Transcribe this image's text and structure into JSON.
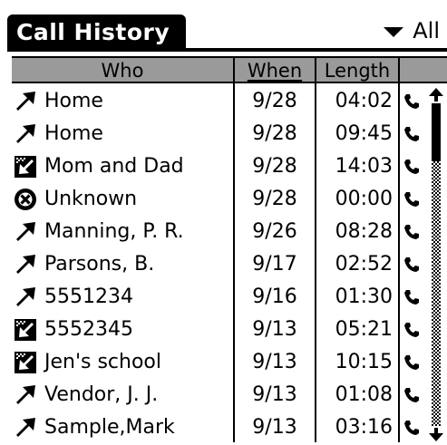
{
  "title": "Call History",
  "category": {
    "selected": "All",
    "icon": "dropdown-triangle-icon"
  },
  "table": {
    "columns": [
      "Who",
      "When",
      "Length"
    ],
    "sorted_by": "When",
    "rows": [
      {
        "type": "outgoing",
        "icon": "outgoing-call-icon",
        "who": "Home",
        "when": "9/28",
        "length": "04:02"
      },
      {
        "type": "outgoing",
        "icon": "outgoing-call-icon",
        "who": "Home",
        "when": "9/28",
        "length": "09:45"
      },
      {
        "type": "incoming",
        "icon": "incoming-call-icon",
        "who": "Mom and Dad",
        "when": "9/28",
        "length": "14:03"
      },
      {
        "type": "missed",
        "icon": "missed-call-icon",
        "who": "Unknown",
        "when": "9/28",
        "length": "00:00"
      },
      {
        "type": "outgoing",
        "icon": "outgoing-call-icon",
        "who": "Manning, P. R.",
        "when": "9/26",
        "length": "08:28"
      },
      {
        "type": "outgoing",
        "icon": "outgoing-call-icon",
        "who": "Parsons, B.",
        "when": "9/17",
        "length": "02:52"
      },
      {
        "type": "outgoing",
        "icon": "outgoing-call-icon",
        "who": "5551234",
        "when": "9/16",
        "length": "01:30"
      },
      {
        "type": "incoming",
        "icon": "incoming-call-icon",
        "who": "5552345",
        "when": "9/13",
        "length": "05:21"
      },
      {
        "type": "incoming",
        "icon": "incoming-call-icon",
        "who": "Jen's school",
        "when": "9/13",
        "length": "10:15"
      },
      {
        "type": "outgoing",
        "icon": "outgoing-call-icon",
        "who": "Vendor,  J. J.",
        "when": "9/13",
        "length": "01:08"
      },
      {
        "type": "outgoing",
        "icon": "outgoing-call-icon",
        "who": "Sample,Mark",
        "when": "9/13",
        "length": "03:16"
      }
    ]
  },
  "colors": {
    "header_bg": "#9a9a9a",
    "foreground": "#000000",
    "background": "#ffffff"
  }
}
